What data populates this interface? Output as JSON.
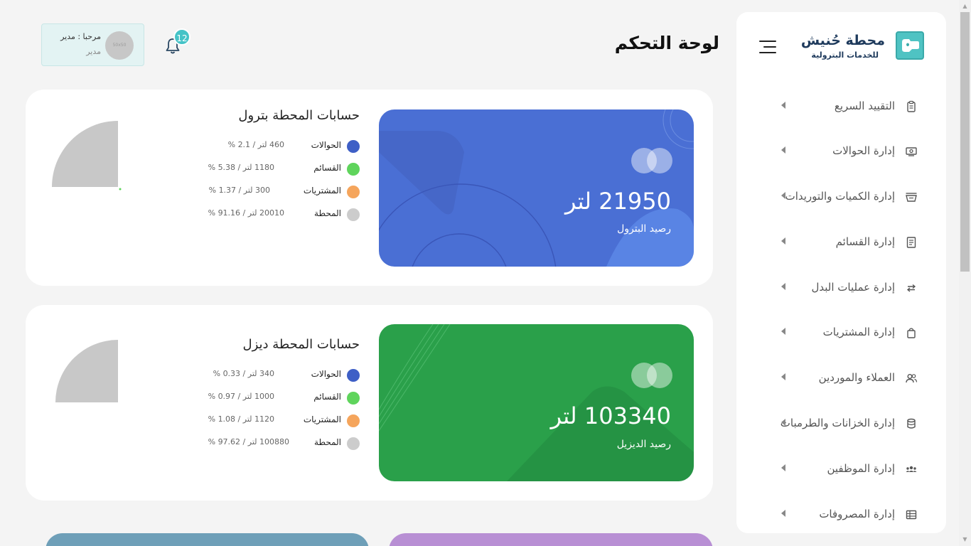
{
  "sidebar": {
    "brand_name": "محطة حُنيش",
    "brand_sub": "للخدمات البترولية",
    "items": [
      {
        "label": "التقييد السريع",
        "icon": "clipboard-icon"
      },
      {
        "label": "إدارة الحوالات",
        "icon": "money-transfer-icon"
      },
      {
        "label": "إدارة الكميات والتوريدات",
        "icon": "basket-icon"
      },
      {
        "label": "إدارة القسائم",
        "icon": "receipt-icon"
      },
      {
        "label": "إدارة عمليات البدل",
        "icon": "swap-arrows-icon"
      },
      {
        "label": "إدارة المشتريات",
        "icon": "shopping-bag-icon"
      },
      {
        "label": "العملاء والموردين",
        "icon": "users-icon"
      },
      {
        "label": "إدارة الخزانات والطرمبات",
        "icon": "database-icon"
      },
      {
        "label": "إدارة الموظفين",
        "icon": "team-icon"
      },
      {
        "label": "إدارة المصروفات",
        "icon": "ledger-icon"
      }
    ]
  },
  "header": {
    "title": "لوحة التحكم",
    "notifications_count": "12",
    "user_greeting": "مرحبا : مدير",
    "user_role": "مدير",
    "avatar_text": "50x50"
  },
  "petrol": {
    "amount": "21950  لتر",
    "label": "رصيد البترول",
    "title": "حسابات المحطة بترول",
    "rows": [
      {
        "name": "الحوالات",
        "value": "460 لتر / 2.1 %",
        "color": "#3e5fc6"
      },
      {
        "name": "القسائم",
        "value": "1180 لتر / 5.38 %",
        "color": "#5fd45c"
      },
      {
        "name": "المشتريات",
        "value": "300 لتر / 1.37 %",
        "color": "#f5a55c"
      },
      {
        "name": "المحطة",
        "value": "20010 لتر / 91.16 %",
        "color": "#cccccc"
      }
    ]
  },
  "diesel": {
    "amount": "103340  لتر",
    "label": "رصيد الديزيل",
    "title": "حسابات المحطة ديزل",
    "rows": [
      {
        "name": "الحوالات",
        "value": "340 لتر / 0.33 %",
        "color": "#3e5fc6"
      },
      {
        "name": "القسائم",
        "value": "1000 لتر / 0.97 %",
        "color": "#5fd45c"
      },
      {
        "name": "المشتريات",
        "value": "1120 لتر / 1.08 %",
        "color": "#f5a55c"
      },
      {
        "name": "المحطة",
        "value": "100880 لتر / 97.62 %",
        "color": "#cccccc"
      }
    ]
  },
  "colors": {
    "petrol_card": "#4a6fd4",
    "diesel_card": "#2aa04a",
    "accent": "#45c3c7"
  }
}
